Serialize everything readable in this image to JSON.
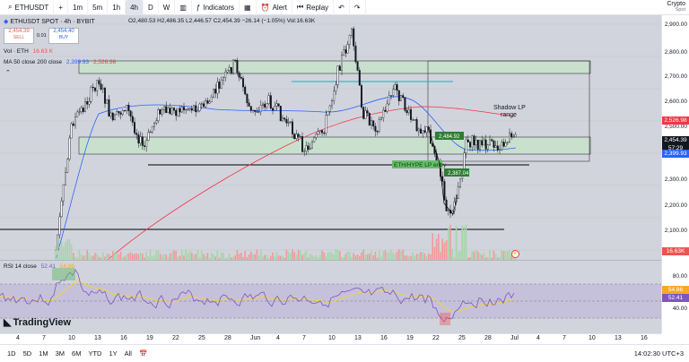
{
  "toolbar": {
    "symbol": "ETHUSDT",
    "timeframes": [
      "1m",
      "5m",
      "1h",
      "4h",
      "D",
      "W"
    ],
    "active_timeframe": "4h",
    "indicators_label": "Indicators",
    "alert_label": "Alert",
    "replay_label": "Replay",
    "crypto_label": "Crypto",
    "crypto_sub": "Spot"
  },
  "legend": {
    "title": "ETHUSDT SPOT · 4h · BYBIT",
    "ohlc": "O2,480.53 H2,486.35 L2,446.57 C2,454.39 −26.14 (−1.05%) Vol:16.63K",
    "sell_price": "2,454.39",
    "sell_label": "SELL",
    "spread": "0.01",
    "buy_price": "2,454.40",
    "buy_label": "BUY",
    "vol_label": "Vol · ETH",
    "vol_value": "16.63 K",
    "ma_label": "MA 50 close 200 close",
    "ma50_value": "2,399.93",
    "ma200_value": "2,526.98",
    "rsi_label": "RSI 14 close",
    "rsi_value1": "52.41",
    "rsi_value2": "54.86"
  },
  "price_axis": {
    "labels": [
      "2,900.00",
      "2,800.00",
      "2,700.00",
      "2,600.00",
      "2,500.00",
      "2,300.00",
      "2,200.00",
      "2,100.00"
    ],
    "tag_ma200": "2,526.98",
    "tag_price": "2,454.39",
    "tag_countdown": "57:29",
    "tag_ma50": "2,399.93",
    "tag_vol": "16.63K"
  },
  "rsi_axis": {
    "labels": [
      "80.00",
      "40.00"
    ],
    "tag_upper": "54.86",
    "tag_lower": "52.41"
  },
  "annotations": {
    "shadow_lp": "Shadow LP",
    "shadow_range": "range",
    "eth_hype": "ETH/HYPE LP entry",
    "box1": "2,484.92",
    "box2": "2,387.04"
  },
  "time_axis": [
    "4",
    "7",
    "10",
    "13",
    "16",
    "19",
    "22",
    "25",
    "28",
    "Jun",
    "4",
    "7",
    "10",
    "13",
    "16",
    "19",
    "22",
    "25",
    "28",
    "Jul",
    "4",
    "7",
    "10",
    "13",
    "16"
  ],
  "bottombar": {
    "ranges": [
      "1D",
      "5D",
      "1M",
      "3M",
      "6M",
      "YTD",
      "1Y",
      "All"
    ],
    "clock": "14:02:30 UTC+3"
  },
  "brand": "TradingView",
  "colors": {
    "up": "#26a69a",
    "down": "#ef5350",
    "ma50": "#2962ff",
    "ma200": "#f23645",
    "zone": "#c8e6c9",
    "rsi": "#7e57c2"
  }
}
